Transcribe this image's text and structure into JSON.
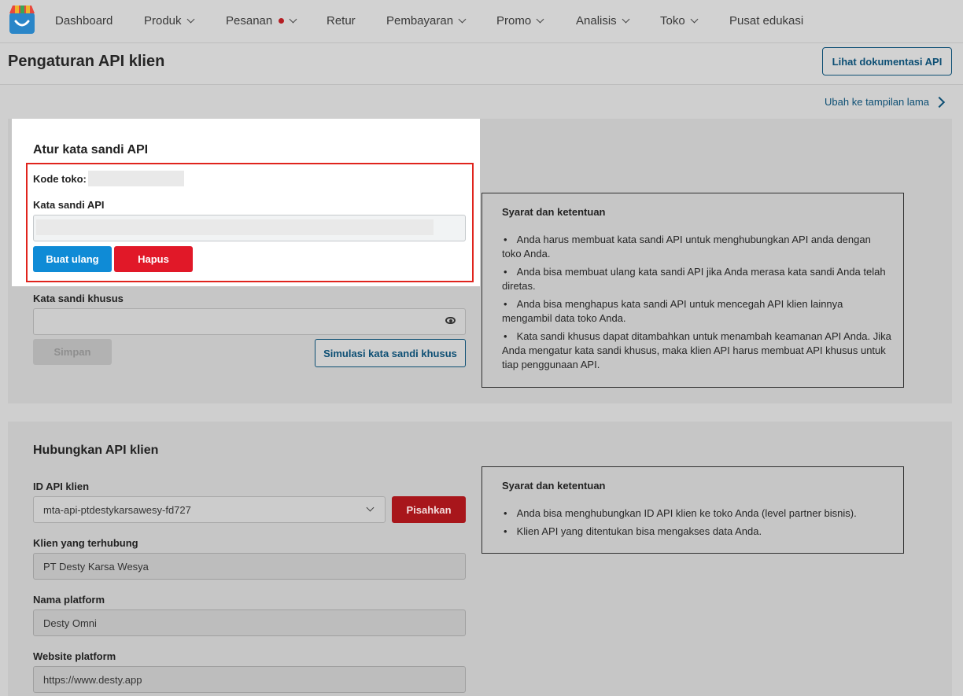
{
  "nav": {
    "items": [
      {
        "label": "Dashboard",
        "chevron": false,
        "dot": false
      },
      {
        "label": "Produk",
        "chevron": true,
        "dot": false
      },
      {
        "label": "Pesanan",
        "chevron": true,
        "dot": true
      },
      {
        "label": "Retur",
        "chevron": false,
        "dot": false
      },
      {
        "label": "Pembayaran",
        "chevron": true,
        "dot": false
      },
      {
        "label": "Promo",
        "chevron": true,
        "dot": false
      },
      {
        "label": "Analisis",
        "chevron": true,
        "dot": false
      },
      {
        "label": "Toko",
        "chevron": true,
        "dot": false
      },
      {
        "label": "Pusat edukasi",
        "chevron": false,
        "dot": false
      }
    ]
  },
  "header": {
    "title": "Pengaturan API klien",
    "doc_button": "Lihat dokumentasi API",
    "old_view_link": "Ubah ke tampilan lama"
  },
  "api_password": {
    "section_title": "Atur kata sandi API",
    "shop_code_label": "Kode toko:",
    "api_password_label": "Kata sandi API",
    "regenerate_button": "Buat ulang",
    "delete_button": "Hapus",
    "custom_password_label": "Kata sandi khusus",
    "custom_password_value": "",
    "save_button": "Simpan",
    "simulate_button": "Simulasi kata sandi khusus",
    "terms": {
      "title": "Syarat dan ketentuan",
      "items": [
        "Anda harus membuat kata sandi API untuk menghubungkan API anda dengan toko Anda.",
        "Anda bisa membuat ulang kata sandi API jika Anda merasa kata sandi Anda telah diretas.",
        "Anda bisa menghapus kata sandi API untuk mencegah API klien lainnya mengambil data toko Anda.",
        "Kata sandi khusus dapat ditambahkan untuk menambah keamanan API Anda. Jika Anda mengatur kata sandi khusus, maka klien API harus membuat API khusus untuk tiap penggunaan API."
      ]
    }
  },
  "connect_client": {
    "section_title": "Hubungkan API klien",
    "client_id_label": "ID API klien",
    "client_id_value": "mta-api-ptdestykarsawesy-fd727",
    "disconnect_button": "Pisahkan",
    "connected_client_label": "Klien yang terhubung",
    "connected_client_value": "PT Desty Karsa Wesya",
    "platform_name_label": "Nama platform",
    "platform_name_value": "Desty Omni",
    "platform_website_label": "Website platform",
    "platform_website_value": "https://www.desty.app",
    "terms": {
      "title": "Syarat dan ketentuan",
      "items": [
        "Anda bisa menghubungkan ID API klien ke toko Anda (level partner bisnis).",
        "Klien API yang ditentukan bisa mengakses data Anda."
      ]
    }
  }
}
